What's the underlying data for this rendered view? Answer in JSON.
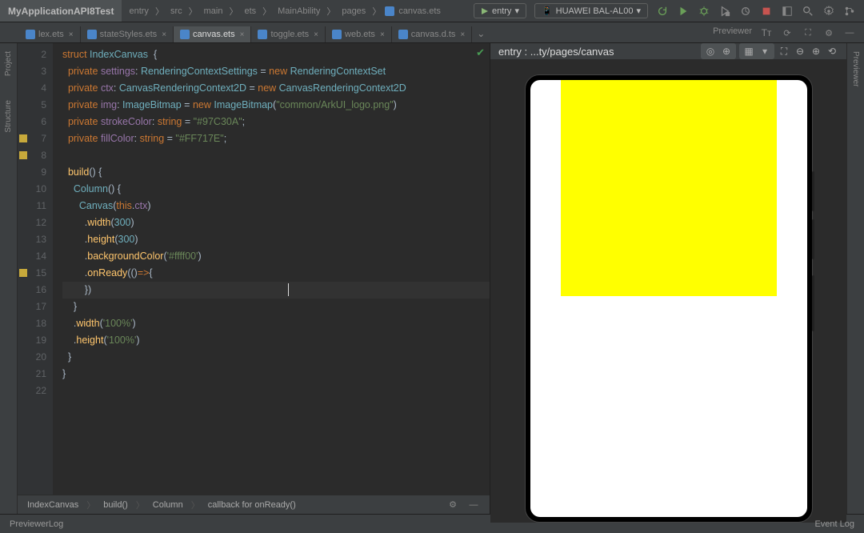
{
  "project": "MyApplicationAPI8Test",
  "breadcrumbs": [
    "entry",
    "src",
    "main",
    "ets",
    "MainAbility",
    "pages",
    "canvas.ets"
  ],
  "top": {
    "runConfig": "entry",
    "device": "HUAWEI BAL-AL00"
  },
  "tabs": [
    {
      "label": "lex.ets",
      "active": false
    },
    {
      "label": "stateStyles.ets",
      "active": false
    },
    {
      "label": "canvas.ets",
      "active": true
    },
    {
      "label": "toggle.ets",
      "active": false
    },
    {
      "label": "web.ets",
      "active": false
    },
    {
      "label": "canvas.d.ts",
      "active": false
    }
  ],
  "previewerLabel": "Previewer",
  "leftTools": [
    "Project",
    "Structure"
  ],
  "rightTools": [
    "Previewer"
  ],
  "preview": {
    "pathText": "entry : ...ty/pages/canvas",
    "canvasColor": "#ffff00"
  },
  "code": {
    "startLine": 2,
    "markedLines": [
      7,
      8,
      15
    ],
    "lines": [
      [
        {
          "t": "struct ",
          "c": "k-orange"
        },
        {
          "t": "IndexCanvas",
          "c": "k-type"
        },
        {
          "t": "  {",
          "c": "k-white"
        }
      ],
      [
        {
          "t": "  private ",
          "c": "k-orange"
        },
        {
          "t": "settings",
          "c": "k-purple"
        },
        {
          "t": ": ",
          "c": "k-white"
        },
        {
          "t": "RenderingContextSettings",
          "c": "k-type"
        },
        {
          "t": " = ",
          "c": "k-white"
        },
        {
          "t": "new ",
          "c": "k-orange"
        },
        {
          "t": "RenderingContextSet",
          "c": "k-type"
        }
      ],
      [
        {
          "t": "  private ",
          "c": "k-orange"
        },
        {
          "t": "ctx",
          "c": "k-purple"
        },
        {
          "t": ": ",
          "c": "k-white"
        },
        {
          "t": "CanvasRenderingContext2D",
          "c": "k-type"
        },
        {
          "t": " = ",
          "c": "k-white"
        },
        {
          "t": "new ",
          "c": "k-orange"
        },
        {
          "t": "CanvasRenderingContext2D",
          "c": "k-type"
        }
      ],
      [
        {
          "t": "  private ",
          "c": "k-orange"
        },
        {
          "t": "img",
          "c": "k-purple"
        },
        {
          "t": ": ",
          "c": "k-white"
        },
        {
          "t": "ImageBitmap",
          "c": "k-type"
        },
        {
          "t": " = ",
          "c": "k-white"
        },
        {
          "t": "new ",
          "c": "k-orange"
        },
        {
          "t": "ImageBitmap",
          "c": "k-type"
        },
        {
          "t": "(",
          "c": "k-white"
        },
        {
          "t": "\"common/ArkUI_logo.png\"",
          "c": "k-str"
        },
        {
          "t": ")",
          "c": "k-white"
        }
      ],
      [
        {
          "t": "  private ",
          "c": "k-orange"
        },
        {
          "t": "strokeColor",
          "c": "k-purple"
        },
        {
          "t": ": ",
          "c": "k-white"
        },
        {
          "t": "string",
          "c": "k-orange"
        },
        {
          "t": " = ",
          "c": "k-white"
        },
        {
          "t": "\"#97C30A\"",
          "c": "k-str"
        },
        {
          "t": ";",
          "c": "k-white"
        }
      ],
      [
        {
          "t": "  private ",
          "c": "k-orange"
        },
        {
          "t": "fillColor",
          "c": "k-purple"
        },
        {
          "t": ": ",
          "c": "k-white"
        },
        {
          "t": "string",
          "c": "k-orange"
        },
        {
          "t": " = ",
          "c": "k-white"
        },
        {
          "t": "\"#FF717E\"",
          "c": "k-str"
        },
        {
          "t": ";",
          "c": "k-white"
        }
      ],
      [
        {
          "t": "",
          "c": "k-white"
        }
      ],
      [
        {
          "t": "  ",
          "c": "k-white"
        },
        {
          "t": "build",
          "c": "k-yellow"
        },
        {
          "t": "() {",
          "c": "k-white"
        }
      ],
      [
        {
          "t": "    ",
          "c": "k-white"
        },
        {
          "t": "Column",
          "c": "k-type"
        },
        {
          "t": "() {",
          "c": "k-white"
        }
      ],
      [
        {
          "t": "      ",
          "c": "k-white"
        },
        {
          "t": "Canvas",
          "c": "k-type"
        },
        {
          "t": "(",
          "c": "k-white"
        },
        {
          "t": "this",
          "c": "k-orange"
        },
        {
          "t": ".",
          "c": "k-white"
        },
        {
          "t": "ctx",
          "c": "k-purple"
        },
        {
          "t": ")",
          "c": "k-white"
        }
      ],
      [
        {
          "t": "        .",
          "c": "k-white"
        },
        {
          "t": "width",
          "c": "k-yellow"
        },
        {
          "t": "(",
          "c": "k-white"
        },
        {
          "t": "300",
          "c": "k-type"
        },
        {
          "t": ")",
          "c": "k-white"
        }
      ],
      [
        {
          "t": "        .",
          "c": "k-white"
        },
        {
          "t": "height",
          "c": "k-yellow"
        },
        {
          "t": "(",
          "c": "k-white"
        },
        {
          "t": "300",
          "c": "k-type"
        },
        {
          "t": ")",
          "c": "k-white"
        }
      ],
      [
        {
          "t": "        .",
          "c": "k-white"
        },
        {
          "t": "backgroundColor",
          "c": "k-yellow"
        },
        {
          "t": "(",
          "c": "k-white"
        },
        {
          "t": "'#ffff00'",
          "c": "k-str"
        },
        {
          "t": ")",
          "c": "k-white"
        }
      ],
      [
        {
          "t": "        .",
          "c": "k-white"
        },
        {
          "t": "onReady",
          "c": "k-yellow"
        },
        {
          "t": "(()",
          "c": "k-white"
        },
        {
          "t": "=>",
          "c": "k-orange"
        },
        {
          "t": "{",
          "c": "k-white"
        }
      ],
      [
        {
          "t": "        })",
          "c": "k-white"
        }
      ],
      [
        {
          "t": "    }",
          "c": "k-white"
        }
      ],
      [
        {
          "t": "    .",
          "c": "k-white"
        },
        {
          "t": "width",
          "c": "k-yellow"
        },
        {
          "t": "(",
          "c": "k-white"
        },
        {
          "t": "'100%'",
          "c": "k-str"
        },
        {
          "t": ")",
          "c": "k-white"
        }
      ],
      [
        {
          "t": "    .",
          "c": "k-white"
        },
        {
          "t": "height",
          "c": "k-yellow"
        },
        {
          "t": "(",
          "c": "k-white"
        },
        {
          "t": "'100%'",
          "c": "k-str"
        },
        {
          "t": ")",
          "c": "k-white"
        }
      ],
      [
        {
          "t": "  }",
          "c": "k-white"
        }
      ],
      [
        {
          "t": "}",
          "c": "k-white"
        }
      ],
      [
        {
          "t": "",
          "c": "k-white"
        }
      ]
    ]
  },
  "editorBreadcrumb": [
    "IndexCanvas",
    "build()",
    "Column",
    "callback for onReady()"
  ],
  "status": {
    "left": "PreviewerLog",
    "right": "Event Log"
  }
}
